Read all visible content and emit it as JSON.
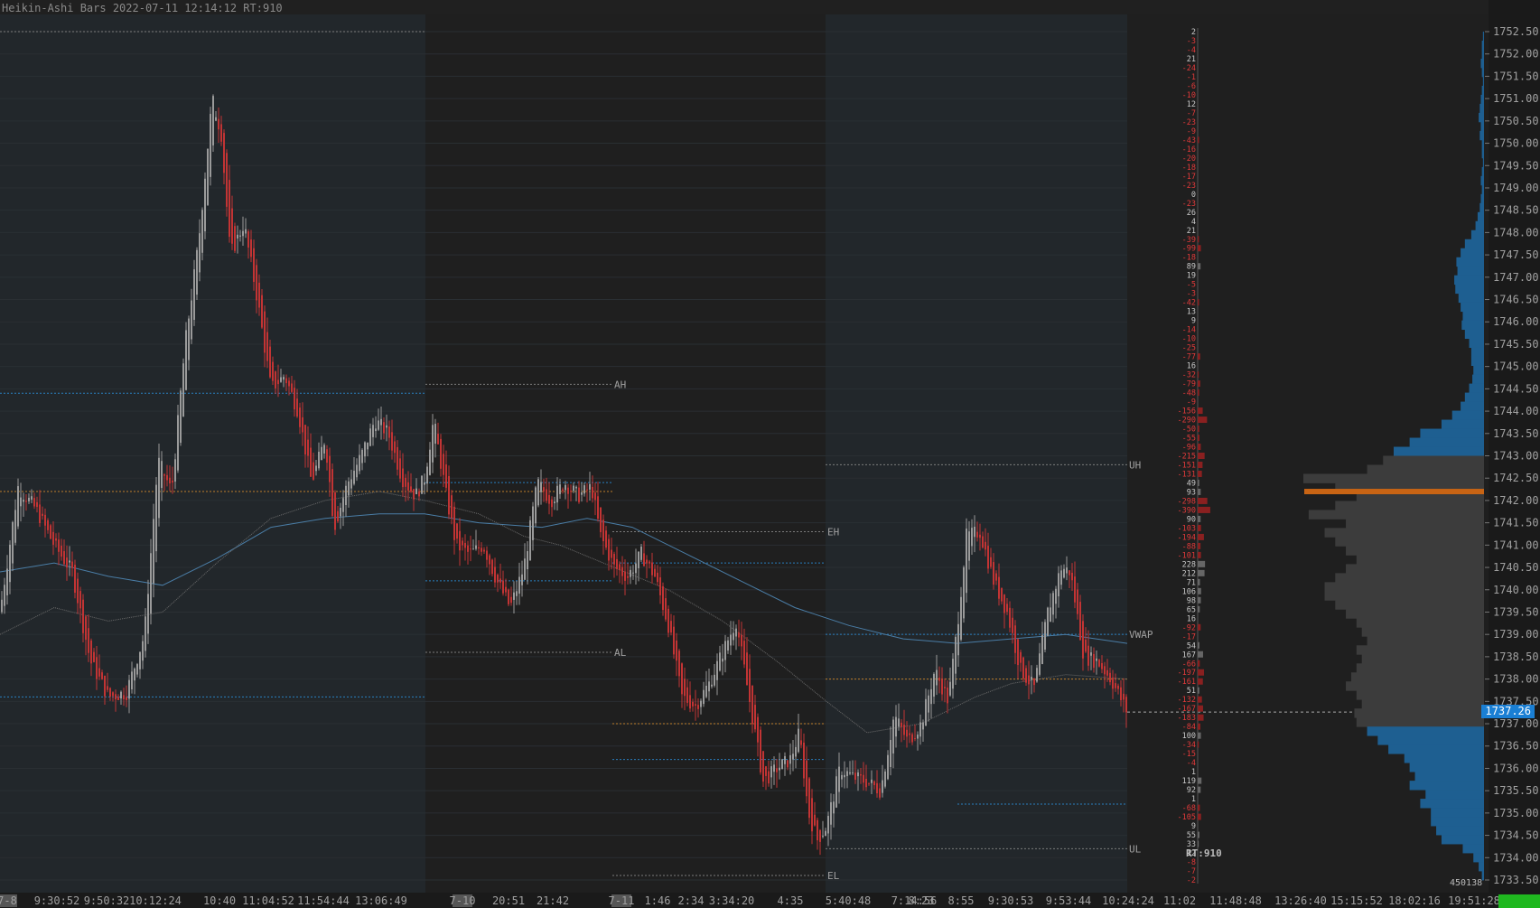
{
  "header": {
    "title": "Heikin-Ashi Bars 2022-07-11 12:14:12 RT:910"
  },
  "rt_label": "RT:910",
  "current_price": "1737.26",
  "volume_total": "450138",
  "colors": {
    "bg": "#1c1c1c",
    "session_bg": "#22272b",
    "up": "#9a9a9a",
    "down": "#c23434",
    "vwap": "#4a7da6",
    "level_blue": "#2b8fd9",
    "level_orange": "#d98d2b",
    "vp_value_area": "#3c3c3c",
    "vp_outside": "#1e5f91",
    "poc": "#c86414"
  },
  "chart_data": {
    "type": "candlestick",
    "style": "Heikin-Ashi",
    "y_axis": {
      "min": 1733.5,
      "max": 1752.5,
      "ticks": [
        "1733.50",
        "1734.00",
        "1734.50",
        "1735.00",
        "1735.50",
        "1736.00",
        "1736.50",
        "1737.00",
        "1737.50",
        "1738.00",
        "1738.50",
        "1739.00",
        "1739.50",
        "1740.00",
        "1740.50",
        "1741.00",
        "1741.50",
        "1742.00",
        "1742.50",
        "1743.00",
        "1743.50",
        "1744.00",
        "1744.50",
        "1745.00",
        "1745.50",
        "1746.00",
        "1746.50",
        "1747.00",
        "1747.50",
        "1748.00",
        "1748.50",
        "1749.00",
        "1749.50",
        "1750.00",
        "1750.50",
        "1751.00",
        "1751.50",
        "1752.00",
        "1752.50"
      ]
    },
    "x_ticks": [
      {
        "label": "7-8",
        "highlight": true
      },
      {
        "label": "9:30:52"
      },
      {
        "label": "9:50:32"
      },
      {
        "label": "10:12:24"
      },
      {
        "label": "10:40"
      },
      {
        "label": "11:04:52"
      },
      {
        "label": "11:54:44"
      },
      {
        "label": "13:06:49"
      },
      {
        "label": "7-10",
        "highlight": true
      },
      {
        "label": "20:51"
      },
      {
        "label": "21:42"
      },
      {
        "label": "7-11",
        "highlight": true
      },
      {
        "label": "1:46"
      },
      {
        "label": "2:34"
      },
      {
        "label": "3:34:20"
      },
      {
        "label": "4:35"
      },
      {
        "label": "5:40:48"
      },
      {
        "label": "7:14:56"
      },
      {
        "label": "8:23"
      },
      {
        "label": "8:55"
      },
      {
        "label": "9:30:53"
      },
      {
        "label": "9:53:44"
      },
      {
        "label": "10:24:24"
      },
      {
        "label": "11:02"
      },
      {
        "label": "11:48:48"
      },
      {
        "label": "13:26:40"
      },
      {
        "label": "15:15:52"
      },
      {
        "label": "18:02:16"
      },
      {
        "label": "19:51:28"
      }
    ],
    "close_path": [
      [
        0,
        1739.5
      ],
      [
        20,
        1742.3
      ],
      [
        40,
        1741.8
      ],
      [
        60,
        1741.0
      ],
      [
        80,
        1740.4
      ],
      [
        100,
        1738.4
      ],
      [
        120,
        1737.6
      ],
      [
        140,
        1737.7
      ],
      [
        160,
        1739.0
      ],
      [
        175,
        1742.9
      ],
      [
        190,
        1742.2
      ],
      [
        205,
        1745.5
      ],
      [
        220,
        1747.8
      ],
      [
        235,
        1751.0
      ],
      [
        245,
        1750.2
      ],
      [
        255,
        1747.5
      ],
      [
        270,
        1748.2
      ],
      [
        285,
        1746.5
      ],
      [
        300,
        1744.5
      ],
      [
        315,
        1744.8
      ],
      [
        330,
        1744.0
      ],
      [
        345,
        1742.4
      ],
      [
        360,
        1743.4
      ],
      [
        370,
        1741.4
      ],
      [
        385,
        1742.4
      ],
      [
        400,
        1743.0
      ],
      [
        415,
        1743.8
      ],
      [
        430,
        1743.5
      ],
      [
        445,
        1742.5
      ],
      [
        460,
        1742.1
      ],
      [
        470,
        1742.5
      ],
      [
        480,
        1743.8
      ],
      [
        495,
        1742.0
      ],
      [
        505,
        1741.0
      ],
      [
        520,
        1740.8
      ],
      [
        535,
        1741.0
      ],
      [
        550,
        1740.2
      ],
      [
        565,
        1739.6
      ],
      [
        580,
        1740.5
      ],
      [
        595,
        1742.4
      ],
      [
        610,
        1742.0
      ],
      [
        625,
        1742.4
      ],
      [
        640,
        1742.1
      ],
      [
        655,
        1742.3
      ],
      [
        665,
        1741.2
      ],
      [
        680,
        1740.5
      ],
      [
        695,
        1740.3
      ],
      [
        710,
        1740.8
      ],
      [
        725,
        1740.3
      ],
      [
        740,
        1739.2
      ],
      [
        755,
        1737.6
      ],
      [
        770,
        1737.4
      ],
      [
        785,
        1737.9
      ],
      [
        800,
        1738.6
      ],
      [
        815,
        1739.3
      ],
      [
        830,
        1737.5
      ],
      [
        845,
        1735.7
      ],
      [
        860,
        1736.0
      ],
      [
        875,
        1736.2
      ],
      [
        885,
        1736.8
      ],
      [
        895,
        1735.0
      ],
      [
        905,
        1734.4
      ],
      [
        915,
        1734.7
      ],
      [
        930,
        1736.0
      ],
      [
        945,
        1735.8
      ],
      [
        960,
        1735.7
      ],
      [
        975,
        1735.5
      ],
      [
        990,
        1737.2
      ],
      [
        1005,
        1736.6
      ],
      [
        1020,
        1737.0
      ],
      [
        1035,
        1738.2
      ],
      [
        1050,
        1737.5
      ],
      [
        1060,
        1739.2
      ],
      [
        1070,
        1741.2
      ],
      [
        1085,
        1741.3
      ],
      [
        1100,
        1740.2
      ],
      [
        1115,
        1739.5
      ],
      [
        1130,
        1738.2
      ],
      [
        1145,
        1737.8
      ],
      [
        1160,
        1739.5
      ],
      [
        1175,
        1740.5
      ],
      [
        1185,
        1740.4
      ],
      [
        1200,
        1738.5
      ],
      [
        1215,
        1738.4
      ],
      [
        1230,
        1738.0
      ],
      [
        1248,
        1737.26
      ]
    ],
    "vwap_path": [
      [
        0,
        1740.4
      ],
      [
        60,
        1740.6
      ],
      [
        120,
        1740.3
      ],
      [
        180,
        1740.1
      ],
      [
        240,
        1740.7
      ],
      [
        300,
        1741.4
      ],
      [
        360,
        1741.6
      ],
      [
        420,
        1741.7
      ],
      [
        470,
        1741.7
      ],
      [
        530,
        1741.5
      ],
      [
        600,
        1741.4
      ],
      [
        650,
        1741.6
      ],
      [
        700,
        1741.4
      ],
      [
        760,
        1740.8
      ],
      [
        820,
        1740.2
      ],
      [
        880,
        1739.6
      ],
      [
        940,
        1739.2
      ],
      [
        1000,
        1738.9
      ],
      [
        1060,
        1738.8
      ],
      [
        1120,
        1738.9
      ],
      [
        1180,
        1739.0
      ],
      [
        1248,
        1738.8
      ]
    ],
    "ma_path": [
      [
        0,
        1739.0
      ],
      [
        60,
        1739.6
      ],
      [
        120,
        1739.3
      ],
      [
        180,
        1739.5
      ],
      [
        240,
        1740.6
      ],
      [
        300,
        1741.6
      ],
      [
        360,
        1742.0
      ],
      [
        420,
        1742.2
      ],
      [
        470,
        1742.0
      ],
      [
        530,
        1741.7
      ],
      [
        580,
        1741.2
      ],
      [
        620,
        1741.0
      ],
      [
        680,
        1740.5
      ],
      [
        740,
        1740.0
      ],
      [
        800,
        1739.3
      ],
      [
        860,
        1738.4
      ],
      [
        915,
        1737.5
      ],
      [
        960,
        1736.8
      ],
      [
        1020,
        1737.0
      ],
      [
        1080,
        1737.6
      ],
      [
        1120,
        1737.9
      ],
      [
        1180,
        1738.1
      ],
      [
        1248,
        1738.0
      ]
    ],
    "sessions": [
      {
        "from": 0,
        "to": 471,
        "shade": true
      },
      {
        "from": 471,
        "to": 678,
        "shade": false
      },
      {
        "from": 678,
        "to": 914,
        "shade": false
      },
      {
        "from": 914,
        "to": 1248,
        "shade": true
      }
    ],
    "levels": [
      {
        "price": 1752.5,
        "from": 0,
        "to": 471,
        "color": "dotted",
        "label": ""
      },
      {
        "price": 1744.4,
        "from": 0,
        "to": 471,
        "color": "blue",
        "label": ""
      },
      {
        "price": 1742.2,
        "from": 0,
        "to": 678,
        "color": "orange",
        "label": ""
      },
      {
        "price": 1737.6,
        "from": 0,
        "to": 471,
        "color": "blue",
        "label": ""
      },
      {
        "price": 1744.6,
        "from": 471,
        "to": 678,
        "color": "dotted",
        "label": "AH"
      },
      {
        "price": 1738.6,
        "from": 471,
        "to": 678,
        "color": "dotted",
        "label": "AL"
      },
      {
        "price": 1742.4,
        "from": 471,
        "to": 678,
        "color": "blue",
        "label": ""
      },
      {
        "price": 1740.2,
        "from": 471,
        "to": 678,
        "color": "blue",
        "label": ""
      },
      {
        "price": 1741.3,
        "from": 678,
        "to": 914,
        "color": "dotted",
        "label": "EH"
      },
      {
        "price": 1733.6,
        "from": 678,
        "to": 914,
        "color": "dotted",
        "label": "EL"
      },
      {
        "price": 1740.6,
        "from": 678,
        "to": 914,
        "color": "blue",
        "label": ""
      },
      {
        "price": 1737.0,
        "from": 678,
        "to": 914,
        "color": "orange",
        "label": ""
      },
      {
        "price": 1736.2,
        "from": 678,
        "to": 914,
        "color": "blue",
        "label": ""
      },
      {
        "price": 1742.8,
        "from": 914,
        "to": 1248,
        "color": "dotted",
        "label": "UH"
      },
      {
        "price": 1734.2,
        "from": 914,
        "to": 1248,
        "color": "dotted",
        "label": "UL"
      },
      {
        "price": 1739.0,
        "from": 914,
        "to": 1248,
        "color": "blue",
        "label": "VWAP"
      },
      {
        "price": 1738.0,
        "from": 914,
        "to": 1248,
        "color": "orange",
        "label": ""
      },
      {
        "price": 1735.2,
        "from": 1060,
        "to": 1248,
        "color": "blue",
        "label": ""
      }
    ],
    "delta_by_price": [
      "2",
      "-3",
      "-4",
      "21",
      "-24",
      "-1",
      "-6",
      "-10",
      "12",
      "-7",
      "-23",
      "-9",
      "-43",
      "-16",
      "-20",
      "-18",
      "-17",
      "-23",
      "0",
      "-23",
      "26",
      "4",
      "21",
      "-39",
      "-99",
      "-18",
      "89",
      "19",
      "-5",
      "-3",
      "-42",
      "13",
      "9",
      "-14",
      "-10",
      "-25",
      "-77",
      "16",
      "-32",
      "-79",
      "-48",
      "-9",
      "-156",
      "-290",
      "-50",
      "-55",
      "-96",
      "-215",
      "-151",
      "-131",
      "49",
      "93",
      "-298",
      "-390",
      "90",
      "-103",
      "-194",
      "-88",
      "-101",
      "228",
      "212",
      "71",
      "106",
      "98",
      "65",
      "16",
      "-92",
      "-17",
      "54",
      "167",
      "-66",
      "-197",
      "-161",
      "51",
      "-132",
      "-167",
      "-183",
      "-84",
      "100",
      "-34",
      "-15",
      "-4",
      "1",
      "119",
      "92",
      "1",
      "-68",
      "-105",
      "9",
      "55",
      "33",
      "12",
      "-8",
      "-7",
      "-2"
    ],
    "volume_profile": [
      1,
      2,
      2,
      3,
      2,
      1,
      2,
      3,
      4,
      5,
      3,
      4,
      2,
      2,
      1,
      2,
      3,
      2,
      3,
      4,
      6,
      8,
      12,
      18,
      22,
      26,
      25,
      28,
      27,
      24,
      22,
      20,
      21,
      18,
      14,
      12,
      12,
      10,
      11,
      14,
      18,
      22,
      30,
      40,
      60,
      70,
      85,
      95,
      110,
      170,
      140,
      120,
      140,
      165,
      130,
      150,
      140,
      130,
      120,
      130,
      140,
      150,
      150,
      140,
      130,
      120,
      115,
      110,
      120,
      115,
      120,
      125,
      130,
      120,
      115,
      122,
      120,
      110,
      100,
      90,
      75,
      70,
      65,
      70,
      55,
      60,
      50,
      50,
      45,
      40,
      20,
      10,
      5,
      2
    ],
    "poc_price": 1742.2,
    "value_area": [
      1737.0,
      1743.0
    ]
  }
}
